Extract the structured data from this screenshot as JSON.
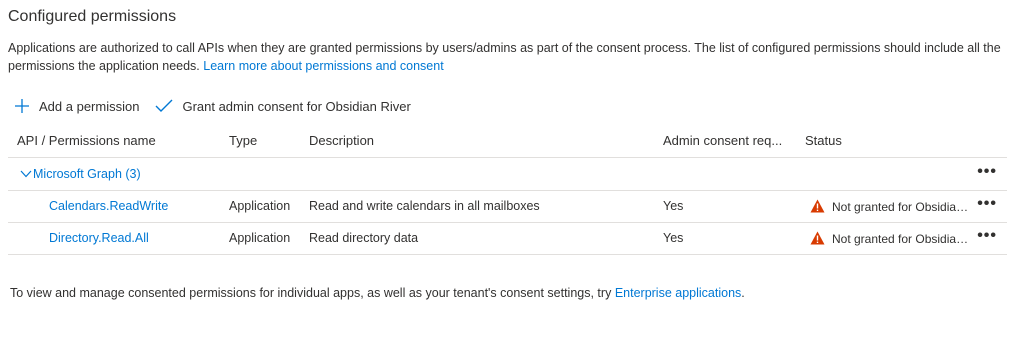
{
  "title": "Configured permissions",
  "description": {
    "text": "Applications are authorized to call APIs when they are granted permissions by users/admins as part of the consent process. The list of configured permissions should include all the permissions the application needs.",
    "link": "Learn more about permissions and consent"
  },
  "toolbar": {
    "add_label": "Add a permission",
    "grant_label": "Grant admin consent for Obsidian River"
  },
  "table": {
    "headers": {
      "api": "API / Permissions name",
      "type": "Type",
      "description": "Description",
      "admin": "Admin consent req...",
      "status": "Status"
    },
    "group": {
      "label": "Microsoft Graph (3)",
      "more": "•••"
    },
    "rows": [
      {
        "name": "Calendars.ReadWrite",
        "type": "Application",
        "description": "Read and write calendars in all mailboxes",
        "admin": "Yes",
        "status": "Not granted for Obsidian River",
        "more": "•••"
      },
      {
        "name": "Directory.Read.All",
        "type": "Application",
        "description": "Read directory data",
        "admin": "Yes",
        "status": "Not granted for Obsidian River",
        "more": "•••"
      }
    ]
  },
  "footer": {
    "text": "To view and manage consented permissions for individual apps, as well as your tenant's consent settings, try",
    "link": "Enterprise applications",
    "end": "."
  },
  "colors": {
    "link": "#0078d4",
    "warning": "#d83b01",
    "border": "#e1dfdd"
  }
}
